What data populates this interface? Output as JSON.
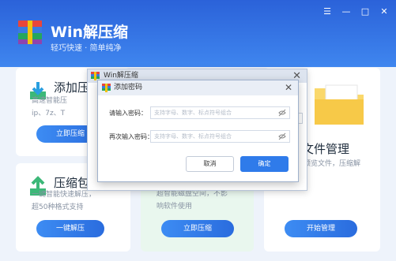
{
  "app": {
    "title": "Win解压缩",
    "subtitle": "轻巧快速 · 简单纯净",
    "window_controls": [
      "☰",
      "—",
      "□",
      "✕"
    ]
  },
  "cards": [
    {
      "title": "添加压",
      "desc": "高速智能压\nip、7z、T",
      "button": "立即压缩"
    },
    {
      "title": "压缩包解",
      "desc": "一键智能快速解压，\n超50种格式支持",
      "button": "一键解压"
    },
    {
      "title": "",
      "desc": "超智能磁盘空间，不影\n响软件使用",
      "button": "立即压缩"
    },
    {
      "title": "文件管理",
      "desc": "预览文件，压缩解",
      "button": "开始管理"
    }
  ],
  "back_dialog": {
    "title": "Win解压缩"
  },
  "dialog": {
    "title": "添加密码",
    "label1": "请输入密码：",
    "label2": "再次输入密码：",
    "placeholder1": "支持字母、数字、标点符号组合",
    "placeholder2": "支持字母、数字、标点符号组合",
    "cancel": "取消",
    "ok": "确定"
  },
  "colors": {
    "accent": "#2a6cde",
    "header": "#2b62d9"
  }
}
